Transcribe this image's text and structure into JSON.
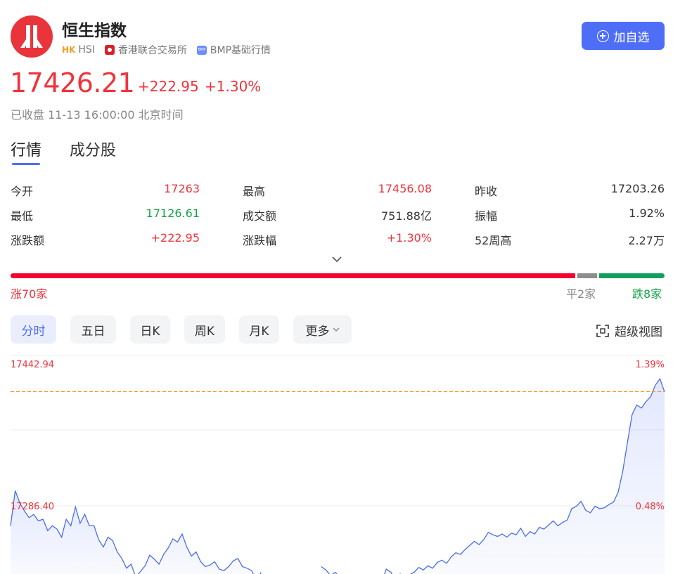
{
  "header": {
    "name": "恒生指数",
    "market_badge": "HK",
    "symbol": "HSI",
    "exchange": "香港联合交易所",
    "data_source_badge": "BMP",
    "data_source": "BMP基础行情",
    "add_button": "加自选"
  },
  "quote": {
    "price": "17426.21",
    "change": "+222.95",
    "change_pct": "+1.30%",
    "status": "已收盘 11-13 16:00:00 北京时间"
  },
  "tabs": [
    "行情",
    "成分股"
  ],
  "stats": [
    {
      "label": "今开",
      "value": "17263",
      "tone": "red"
    },
    {
      "label": "最高",
      "value": "17456.08",
      "tone": "red"
    },
    {
      "label": "昨收",
      "value": "17203.26",
      "tone": "dark"
    },
    {
      "label": "最低",
      "value": "17126.61",
      "tone": "green"
    },
    {
      "label": "成交额",
      "value": "751.88亿",
      "tone": "dark"
    },
    {
      "label": "振幅",
      "value": "1.92%",
      "tone": "dark"
    },
    {
      "label": "涨跌额",
      "value": "+222.95",
      "tone": "red"
    },
    {
      "label": "涨跌幅",
      "value": "+1.30%",
      "tone": "red"
    },
    {
      "label": "52周高",
      "value": "2.27万",
      "tone": "dark"
    }
  ],
  "breadth": {
    "up": 70,
    "flat": 2,
    "down": 8,
    "up_label": "涨70家",
    "flat_label": "平2家",
    "down_label": "跌8家",
    "colors": {
      "up": "#f5002f",
      "flat": "#8e8e8e",
      "down": "#0ea05a"
    }
  },
  "periods": [
    "分时",
    "五日",
    "日K",
    "周K",
    "月K",
    "更多"
  ],
  "active_period": "分时",
  "super_view_label": "超级视图",
  "colors": {
    "accent": "#4f6ef7",
    "up": "#f0333b",
    "down": "#16a34a",
    "line": "#4a6cf0"
  },
  "chart_data": {
    "type": "line",
    "title": "",
    "ylabels_left": [
      "17442.94",
      "17286.40"
    ],
    "ylabels_right": [
      "1.39%",
      "0.48%"
    ],
    "prev_close": 17203.26,
    "y_top": 17442.94,
    "y_mid": 17286.4,
    "reference_line_value": 17426.21,
    "grid": true,
    "series": [
      {
        "values": [
          17262,
          17305,
          17290,
          17280,
          17272,
          17276,
          17268,
          17270,
          17256,
          17262,
          17258,
          17248,
          17270,
          17262,
          17285,
          17265,
          17276,
          17262,
          17262,
          17245,
          17236,
          17248,
          17244,
          17230,
          17222,
          17210,
          17215,
          17199,
          17206,
          17213,
          17226,
          17221,
          17215,
          17227,
          17235,
          17246,
          17242,
          17252,
          17236,
          17225,
          17230,
          17218,
          17212,
          17214,
          17218,
          17209,
          17207,
          17212,
          17219,
          17222,
          17212,
          17210,
          17207,
          17194,
          17205,
          null,
          null,
          null,
          null,
          null,
          null,
          null,
          null,
          null,
          null,
          null,
          null,
          17212,
          17208,
          17201,
          17205,
          17199,
          17190,
          17194,
          17186,
          17178,
          17180,
          17186,
          17195,
          17201,
          17193,
          17209,
          17205,
          17195,
          17203,
          17186,
          17202,
          17205,
          17211,
          17208,
          17213,
          17210,
          17217,
          17220,
          17216,
          17224,
          17229,
          17227,
          17233,
          17238,
          17243,
          17239,
          17245,
          17254,
          17251,
          17249,
          17252,
          17248,
          17253,
          17251,
          17259,
          17249,
          17255,
          17252,
          17260,
          17258,
          17263,
          17268,
          17262,
          17266,
          17269,
          17283,
          17286,
          17292,
          17281,
          17278,
          17286,
          17283,
          17284,
          17288,
          17291,
          17303,
          17329,
          17364,
          17398,
          17410,
          17406,
          17414,
          17420,
          17434,
          17442,
          17426
        ]
      }
    ]
  }
}
